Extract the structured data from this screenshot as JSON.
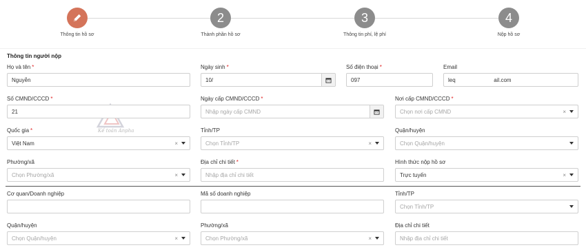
{
  "stepper": {
    "steps": [
      {
        "label": "Thông tin hồ sơ",
        "number": "",
        "icon": "pencil-icon",
        "active": true
      },
      {
        "label": "Thành phần hồ sơ",
        "number": "2"
      },
      {
        "label": "Thông tin phí, lệ phí",
        "number": "3"
      },
      {
        "label": "Nộp hồ sơ",
        "number": "4"
      }
    ],
    "active_color": "#d4745a",
    "inactive_color": "#8c8c8c"
  },
  "section": {
    "title": "Thông tin người nộp"
  },
  "fields": {
    "ho_ten": {
      "label": "Họ và tên",
      "value": "Nguyễn"
    },
    "ngay_sinh": {
      "label": "Ngày sinh",
      "value": "10/"
    },
    "so_dien_thoai": {
      "label": "Số điện thoại",
      "value": "097"
    },
    "email": {
      "label": "Email",
      "value": "leq                         ail.com"
    },
    "so_cmnd": {
      "label": "Số CMND/CCCD",
      "value": "21"
    },
    "ngay_cap": {
      "label": "Ngày cấp CMND/CCCD",
      "placeholder": "Nhập ngày cấp CMND"
    },
    "noi_cap": {
      "label": "Nơi cấp CMND/CCCD",
      "placeholder": "Chọn nơi cấp CMND"
    },
    "quoc_gia": {
      "label": "Quốc gia",
      "value": "Việt Nam"
    },
    "tinh_tp": {
      "label": "Tỉnh/TP",
      "placeholder": "Chọn Tỉnh/TP"
    },
    "quan_huyen": {
      "label": "Quận/huyện",
      "placeholder": "Chọn Quận/huyện"
    },
    "phuong_xa": {
      "label": "Phường/xã",
      "placeholder": "Chọn Phường/xã"
    },
    "dia_chi": {
      "label": "Địa chỉ chi tiết",
      "placeholder": "Nhập địa chỉ chi tiết"
    },
    "hinh_thuc": {
      "label": "Hình thức nộp hồ sơ",
      "value": "Trực tuyến"
    },
    "co_quan": {
      "label": "Cơ quan/Doanh nghiệp",
      "value": ""
    },
    "ma_so_dn": {
      "label": "Mã số doanh nghiệp",
      "value": ""
    },
    "org_tinh_tp": {
      "label": "Tỉnh/TP",
      "placeholder": "Chọn Tỉnh/TP"
    },
    "org_quan_huyen": {
      "label": "Quận/huyện",
      "placeholder": "Chọn Quận/huyện"
    },
    "org_phuong_xa": {
      "label": "Phường/xã",
      "placeholder": "Chọn Phường/xã"
    },
    "org_dia_chi": {
      "label": "Địa chỉ chi tiết",
      "placeholder": "Nhập địa chỉ chi tiết"
    }
  },
  "required_mark": "*",
  "clear_glyph": "×",
  "watermark": {
    "text": "Kế toán Anpha"
  }
}
